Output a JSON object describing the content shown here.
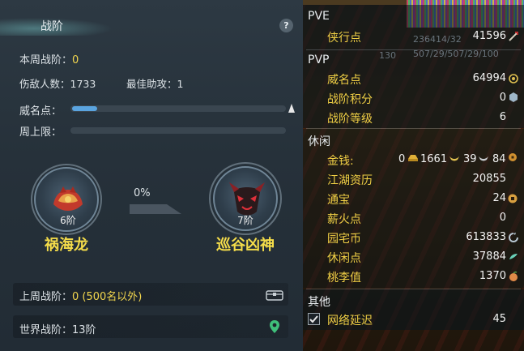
{
  "left": {
    "title": "战阶",
    "help": "?",
    "weekly": {
      "label": "本周战阶：",
      "value": "0"
    },
    "wounded": {
      "label": "伤敌人数：",
      "value": "1733"
    },
    "assist": {
      "label": "最佳助攻：",
      "value": "1"
    },
    "prestige_label": "威名点：",
    "prestige_progress": 0.12,
    "weekly_cap_label": "周上限：",
    "weekly_cap_progress": 0,
    "progress_pct": "0%",
    "current_tier": {
      "num": "6阶",
      "name": "祸海龙"
    },
    "next_tier": {
      "num": "7阶",
      "name": "巡谷凶神"
    },
    "last_week": {
      "label": "上周战阶：",
      "value": "0 (500名以外)"
    },
    "world": {
      "label": "世界战阶：",
      "value": "13阶"
    }
  },
  "right": {
    "ghost_1": "236414/32",
    "ghost_2": "130",
    "ghost_3": "507/29/507/29/100",
    "pve": {
      "title": "PVE",
      "items": [
        {
          "label": "侠行点",
          "value": "41596"
        }
      ]
    },
    "pvp": {
      "title": "PVP",
      "items": [
        {
          "label": "威名点",
          "value": "64994"
        },
        {
          "label": "战阶积分",
          "value": "0"
        },
        {
          "label": "战阶等级",
          "value": "6"
        }
      ]
    },
    "leisure": {
      "title": "休闲",
      "money_label": "金钱:",
      "money": {
        "a": "0",
        "b": "1661",
        "c": "39",
        "d": "84"
      },
      "items": [
        {
          "label": "江湖资历",
          "value": "20855"
        },
        {
          "label": "通宝",
          "value": "24"
        },
        {
          "label": "薪火点",
          "value": "0"
        },
        {
          "label": "园宅币",
          "value": "613833"
        },
        {
          "label": "休闲点",
          "value": "37884"
        },
        {
          "label": "桃李值",
          "value": "1370"
        }
      ]
    },
    "other": {
      "title": "其他",
      "latency_label": "网络延迟",
      "latency_value": "45",
      "latency_checked": true
    }
  }
}
